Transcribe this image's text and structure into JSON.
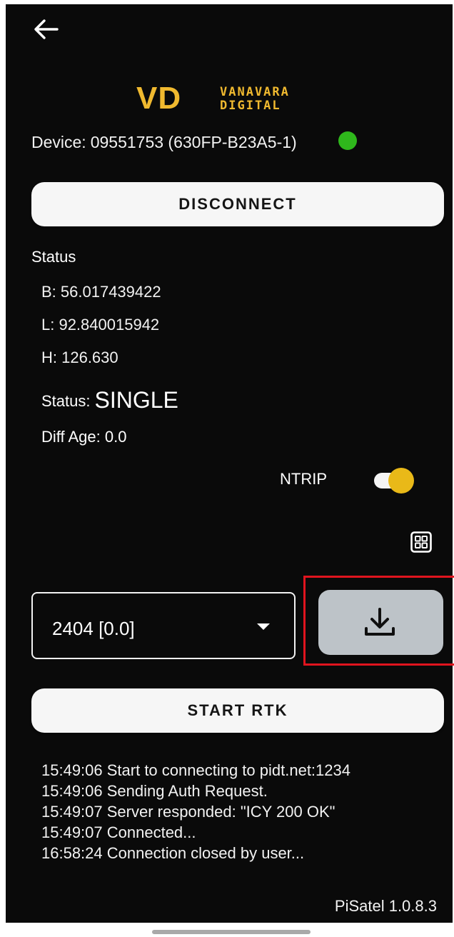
{
  "header": {
    "back_icon": "arrow-left-icon"
  },
  "brand": {
    "logo_mark": "VD",
    "logo_line1": "VANAVARA",
    "logo_line2": "DIGITAL",
    "color": "#f0b92f"
  },
  "device": {
    "label": "Device:",
    "value": "09551753 (630FP-B23A5-1)",
    "indicator_color": "#2fb81c"
  },
  "buttons": {
    "disconnect": "DISCONNECT",
    "start_rtk": "START RTK"
  },
  "status": {
    "heading": "Status",
    "b": "B: 56.017439422",
    "l": "L: 92.840015942",
    "h": "H: 126.630",
    "fix_label": "Status:",
    "fix_value": "SINGLE",
    "diff_age": "Diff Age: 0.0"
  },
  "ntrip": {
    "label": "NTRIP",
    "enabled": true,
    "accent": "#e9b918"
  },
  "grid_icon": "grid-icon",
  "mount_select": {
    "value": "2404 [0.0]",
    "arrow_icon": "caret-down-icon"
  },
  "download": {
    "icon": "download-icon",
    "button_color": "#bdc3c8",
    "highlight_color": "#e0141e"
  },
  "log": [
    "15:49:06 Start to connecting to pidt.net:1234",
    "15:49:06 Sending Auth Request.",
    "15:49:07 Server responded: \"ICY 200 OK\"",
    "15:49:07 Connected...",
    "16:58:24 Connection closed by user..."
  ],
  "footer": {
    "version": "PiSatel 1.0.8.3"
  }
}
